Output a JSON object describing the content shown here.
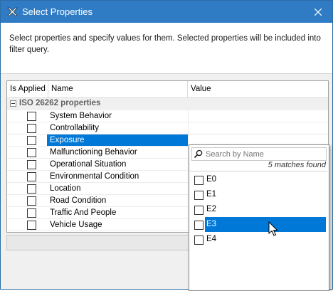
{
  "window": {
    "title": "Select Properties",
    "app_icon": "magicdraw-x-icon",
    "close_icon": "close-icon"
  },
  "description": "Select properties and specify values for them. Selected properties will be included into filter query.",
  "table": {
    "columns": [
      "Is Applied",
      "Name",
      "Value"
    ],
    "group": {
      "label": "ISO 26262 properties",
      "expanded": true
    },
    "rows": [
      {
        "name": "System Behavior",
        "applied": false,
        "value": ""
      },
      {
        "name": "Controllability",
        "applied": false,
        "value": ""
      },
      {
        "name": "Exposure",
        "applied": false,
        "value": "",
        "selected": true
      },
      {
        "name": "Malfunctioning Behavior",
        "applied": false,
        "value": ""
      },
      {
        "name": "Operational Situation",
        "applied": false,
        "value": ""
      },
      {
        "name": "Environmental Condition",
        "applied": false,
        "value": ""
      },
      {
        "name": "Location",
        "applied": false,
        "value": ""
      },
      {
        "name": "Road Condition",
        "applied": false,
        "value": ""
      },
      {
        "name": "Traffic And People",
        "applied": false,
        "value": ""
      },
      {
        "name": "Vehicle Usage",
        "applied": false,
        "value": ""
      }
    ]
  },
  "dropdown": {
    "search_placeholder": "Search by Name",
    "matches": "5 matches found",
    "options": [
      {
        "label": "E0",
        "checked": false
      },
      {
        "label": "E1",
        "checked": false
      },
      {
        "label": "E2",
        "checked": false
      },
      {
        "label": "E3",
        "checked": false,
        "selected": true
      },
      {
        "label": "E4",
        "checked": false
      }
    ]
  },
  "colors": {
    "titlebar": "#2f7cc5",
    "selection": "#0078d7"
  }
}
